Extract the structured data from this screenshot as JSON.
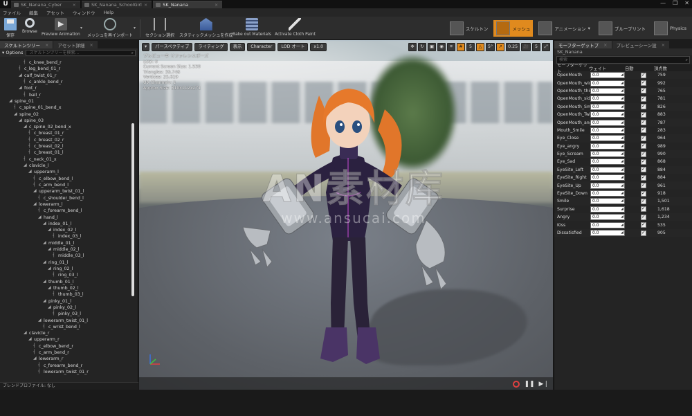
{
  "window": {
    "logo": "U",
    "tabs": [
      {
        "label": "SK_Nanana_Cyber",
        "active": false
      },
      {
        "label": "SK_Nanana_SchoolGirl",
        "active": false
      },
      {
        "label": "SK_Nanana",
        "active": true
      }
    ],
    "close_glyph": "×",
    "controls": {
      "minimize": "—",
      "maximize": "❐",
      "close": "✕"
    }
  },
  "menu": [
    "ファイル",
    "編集",
    "アセット",
    "ウィンドウ",
    "Help"
  ],
  "toolbar": {
    "save": "保存",
    "browse": "Browse",
    "preview_animation": "Preview Animation",
    "reimport": "メッシュを再インポート",
    "section_select": "セクション選択",
    "make_static_mesh": "スタティックメッシュを作成",
    "bake_out_materials": "Bake out Materials",
    "activate_cloth_paint": "Activate Cloth Paint"
  },
  "modes": [
    {
      "label": "スケルトン",
      "active": false
    },
    {
      "label": "メッシュ",
      "active": true
    },
    {
      "label": "アニメーション",
      "active": false
    },
    {
      "label": "ブループリント",
      "active": false
    },
    {
      "label": "Physics",
      "active": false
    }
  ],
  "left_panel": {
    "tabs": [
      {
        "label": "スケルトンツリー",
        "active": true
      },
      {
        "label": "アセット詳細",
        "active": false
      }
    ],
    "options_label": "Options",
    "search_placeholder": "スケルトンツリーを検索...",
    "footer": "ブレンドプロファイル: なし",
    "tree": [
      {
        "label": "c_knee_bend_r",
        "depth": 4,
        "expanded": false
      },
      {
        "label": "c_leg_bend_01_r",
        "depth": 3,
        "expanded": false
      },
      {
        "label": "calf_twist_01_r",
        "depth": 3,
        "expanded": true
      },
      {
        "label": "c_ankle_bend_r",
        "depth": 4,
        "expanded": false
      },
      {
        "label": "foot_r",
        "depth": 3,
        "expanded": true
      },
      {
        "label": "ball_r",
        "depth": 4,
        "expanded": false
      },
      {
        "label": "spine_01",
        "depth": 1,
        "expanded": true
      },
      {
        "label": "c_spine_01_bend_x",
        "depth": 2,
        "expanded": false
      },
      {
        "label": "spine_02",
        "depth": 2,
        "expanded": true
      },
      {
        "label": "spine_03",
        "depth": 3,
        "expanded": true
      },
      {
        "label": "c_spine_02_bend_x",
        "depth": 4,
        "expanded": true
      },
      {
        "label": "c_breast_01_r",
        "depth": 5,
        "expanded": false
      },
      {
        "label": "c_breast_02_r",
        "depth": 5,
        "expanded": false
      },
      {
        "label": "c_breast_02_l",
        "depth": 5,
        "expanded": false
      },
      {
        "label": "c_breast_01_l",
        "depth": 5,
        "expanded": false
      },
      {
        "label": "c_neck_01_x",
        "depth": 4,
        "expanded": false
      },
      {
        "label": "clavicle_l",
        "depth": 4,
        "expanded": true
      },
      {
        "label": "upperarm_l",
        "depth": 5,
        "expanded": true
      },
      {
        "label": "c_elbow_bend_l",
        "depth": 6,
        "expanded": false
      },
      {
        "label": "c_arm_bend_l",
        "depth": 6,
        "expanded": false
      },
      {
        "label": "upperarm_twist_01_l",
        "depth": 6,
        "expanded": true
      },
      {
        "label": "c_shoulder_bend_l",
        "depth": 7,
        "expanded": false
      },
      {
        "label": "lowerarm_l",
        "depth": 6,
        "expanded": true
      },
      {
        "label": "c_forearm_bend_l",
        "depth": 7,
        "expanded": false
      },
      {
        "label": "hand_l",
        "depth": 7,
        "expanded": true
      },
      {
        "label": "index_01_l",
        "depth": 8,
        "expanded": true
      },
      {
        "label": "index_02_l",
        "depth": 9,
        "expanded": true
      },
      {
        "label": "index_03_l",
        "depth": 10,
        "expanded": false
      },
      {
        "label": "middle_01_l",
        "depth": 8,
        "expanded": true
      },
      {
        "label": "middle_02_l",
        "depth": 9,
        "expanded": true
      },
      {
        "label": "middle_03_l",
        "depth": 10,
        "expanded": false
      },
      {
        "label": "ring_01_l",
        "depth": 8,
        "expanded": true
      },
      {
        "label": "ring_02_l",
        "depth": 9,
        "expanded": true
      },
      {
        "label": "ring_03_l",
        "depth": 10,
        "expanded": false
      },
      {
        "label": "thumb_01_l",
        "depth": 8,
        "expanded": true
      },
      {
        "label": "thumb_02_l",
        "depth": 9,
        "expanded": true
      },
      {
        "label": "thumb_03_l",
        "depth": 10,
        "expanded": false
      },
      {
        "label": "pinky_01_l",
        "depth": 8,
        "expanded": true
      },
      {
        "label": "pinky_02_l",
        "depth": 9,
        "expanded": true
      },
      {
        "label": "pinky_03_l",
        "depth": 10,
        "expanded": false
      },
      {
        "label": "lowerarm_twist_01_l",
        "depth": 7,
        "expanded": true
      },
      {
        "label": "c_wrist_bend_l",
        "depth": 8,
        "expanded": false
      },
      {
        "label": "clavicle_r",
        "depth": 4,
        "expanded": true
      },
      {
        "label": "upperarm_r",
        "depth": 5,
        "expanded": true
      },
      {
        "label": "c_elbow_bend_r",
        "depth": 6,
        "expanded": false
      },
      {
        "label": "c_arm_bend_r",
        "depth": 6,
        "expanded": false
      },
      {
        "label": "lowerarm_r",
        "depth": 6,
        "expanded": true
      },
      {
        "label": "c_forearm_bend_r",
        "depth": 7,
        "expanded": false
      },
      {
        "label": "lowerarm_twist_01_r",
        "depth": 7,
        "expanded": false
      }
    ]
  },
  "viewport": {
    "buttons": [
      "パースペクティブ",
      "ライティング",
      "表示",
      "Character",
      "LOD オート",
      "x1.0"
    ],
    "dropdown_glyph": "▾",
    "right_tools": [
      "5",
      "5°",
      "0.25",
      "5"
    ],
    "stats": [
      "プレビュー中 リファレンスポーズ",
      "LOD: 0",
      "Current Screen Size: 1.539",
      "Triangles: 39,748",
      "Vertices: 25,619",
      "UV Channels: 1",
      "Approx Size: 310x112x271"
    ],
    "watermark_main": "AN素材库",
    "watermark_url": "www.ansucai.com"
  },
  "right_panel": {
    "tabs": [
      {
        "label": "モーフターゲットプ",
        "active": true
      },
      {
        "label": "プレビューシーン設",
        "active": false
      }
    ],
    "asset_name": "SK_Nanana",
    "search_placeholder": "検索",
    "columns": [
      "モーフターゲット",
      "ウェイト",
      "自動",
      "頂点数"
    ],
    "morph_targets": [
      {
        "name": "OpenMouth",
        "weight": "0.0",
        "auto": true,
        "verts": "759"
      },
      {
        "name": "OpenMouth_wide",
        "weight": "0.0",
        "auto": true,
        "verts": "992"
      },
      {
        "name": "OpenMouth_thin",
        "weight": "0.0",
        "auto": true,
        "verts": "765"
      },
      {
        "name": "OpenMouth_side",
        "weight": "0.0",
        "auto": true,
        "verts": "781"
      },
      {
        "name": "OpenMouth_Smile",
        "weight": "0.0",
        "auto": true,
        "verts": "826"
      },
      {
        "name": "OpenMouth_Twist",
        "weight": "0.0",
        "auto": true,
        "verts": "883"
      },
      {
        "name": "OpenMouth_angry",
        "weight": "0.0",
        "auto": true,
        "verts": "787"
      },
      {
        "name": "Mouth_Smile",
        "weight": "0.0",
        "auto": true,
        "verts": "283"
      },
      {
        "name": "Eye_Close",
        "weight": "0.0",
        "auto": true,
        "verts": "964"
      },
      {
        "name": "Eye_angry",
        "weight": "0.0",
        "auto": true,
        "verts": "989"
      },
      {
        "name": "Eye_Scream",
        "weight": "0.0",
        "auto": true,
        "verts": "990"
      },
      {
        "name": "Eye_Sad",
        "weight": "0.0",
        "auto": true,
        "verts": "868"
      },
      {
        "name": "EyeSite_Left",
        "weight": "0.0",
        "auto": true,
        "verts": "884"
      },
      {
        "name": "EyeSite_Right",
        "weight": "0.0",
        "auto": true,
        "verts": "884"
      },
      {
        "name": "EyeSite_Up",
        "weight": "0.0",
        "auto": true,
        "verts": "961"
      },
      {
        "name": "EyeSite_Down",
        "weight": "0.0",
        "auto": true,
        "verts": "918"
      },
      {
        "name": "Smile",
        "weight": "0.0",
        "auto": true,
        "verts": "1,501"
      },
      {
        "name": "Surprise",
        "weight": "0.0",
        "auto": true,
        "verts": "1,618"
      },
      {
        "name": "Angry",
        "weight": "0.0",
        "auto": true,
        "verts": "1,234"
      },
      {
        "name": "Kiss",
        "weight": "0.0",
        "auto": true,
        "verts": "535"
      },
      {
        "name": "Dissatisfied",
        "weight": "0.0",
        "auto": true,
        "verts": "905"
      }
    ]
  },
  "colors": {
    "accent": "#e08a1e",
    "panel": "#242424",
    "record": "#e04040"
  }
}
